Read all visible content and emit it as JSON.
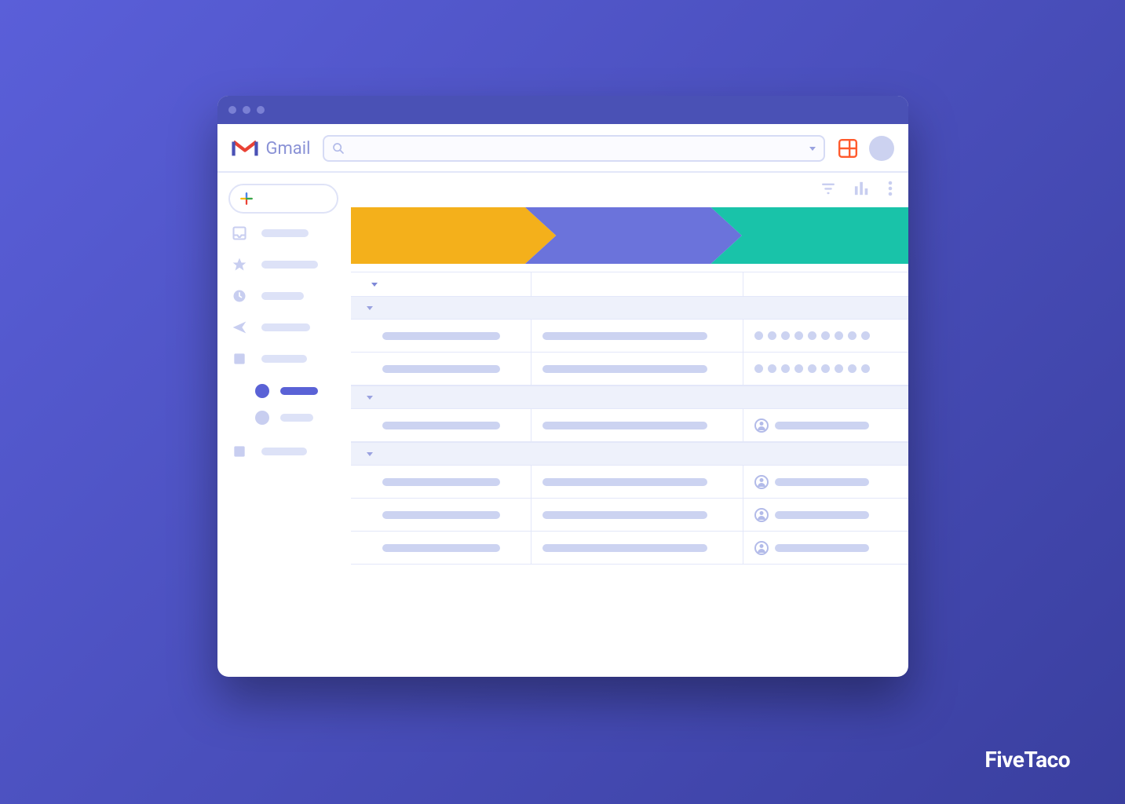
{
  "header": {
    "app_name": "Gmail",
    "search_placeholder": " "
  },
  "watermark": "FiveTaco",
  "colors": {
    "titlebar": "#4a51b5",
    "chevron_1": "#f4b01b",
    "chevron_2": "#6b73db",
    "chevron_3": "#19c3a9",
    "grid_icon": "#ff5a2c",
    "accent": "#5a62d6",
    "muted": "#ccd3f1",
    "border": "#e3e7f9"
  },
  "sidebar": {
    "compose_icon": "plus",
    "items": [
      {
        "icon": "inbox-icon"
      },
      {
        "icon": "star-icon"
      },
      {
        "icon": "clock-icon"
      },
      {
        "icon": "sent-icon"
      },
      {
        "icon": "stop-icon",
        "sub": [
          {
            "active": true
          },
          {
            "active": false
          }
        ]
      },
      {
        "icon": "stop-icon"
      }
    ]
  },
  "pipeline": {
    "stages": [
      {
        "color": "#f4b01b"
      },
      {
        "color": "#6b73db"
      },
      {
        "color": "#19c3a9"
      }
    ]
  },
  "table": {
    "groups": [
      {
        "rows": [
          {
            "col3_type": "dots",
            "dots": 9
          },
          {
            "col3_type": "dots",
            "dots": 9
          }
        ]
      },
      {
        "rows": [
          {
            "col3_type": "person"
          }
        ]
      },
      {
        "rows": [
          {
            "col3_type": "person"
          },
          {
            "col3_type": "person"
          },
          {
            "col3_type": "person"
          }
        ]
      }
    ]
  }
}
